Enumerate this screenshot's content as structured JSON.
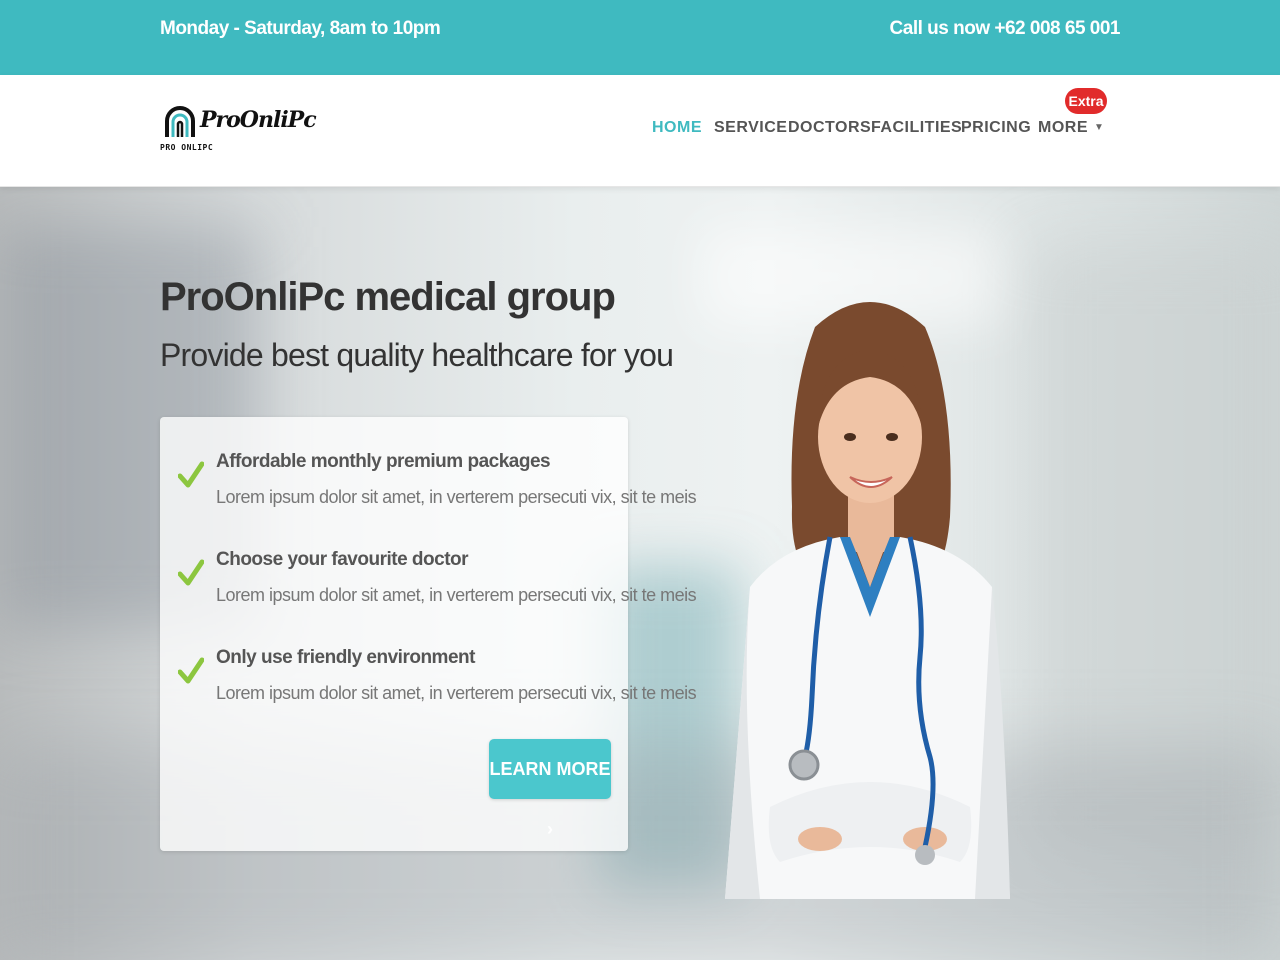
{
  "topbar": {
    "hours": "Monday - Saturday, 8am to 10pm",
    "phone": "Call us now +62 008 65 001"
  },
  "logo": {
    "word": "ProOnliPc",
    "sub": "PRO ONLIPC"
  },
  "nav": {
    "items": [
      {
        "label": "HOME",
        "active": true
      },
      {
        "label": "SERVICE"
      },
      {
        "label": "DOCTORS"
      },
      {
        "label": "FACILITIES"
      },
      {
        "label": "PRICING"
      },
      {
        "label": "MORE"
      }
    ],
    "more_badge": "Extra",
    "caret_icon": "caret-down-icon"
  },
  "hero": {
    "title": "ProOnliPc medical group",
    "subtitle": "Provide best quality healthcare for you",
    "features": [
      {
        "title": "Affordable monthly premium packages",
        "desc": "Lorem ipsum dolor sit amet, in verterem persecuti vix, sit te meis",
        "icon": "check-icon"
      },
      {
        "title": "Choose your favourite doctor",
        "desc": "Lorem ipsum dolor sit amet, in verterem persecuti vix, sit te meis",
        "icon": "check-icon"
      },
      {
        "title": "Only use friendly environment",
        "desc": "Lorem ipsum dolor sit amet, in verterem persecuti vix, sit te meis",
        "icon": "check-icon"
      }
    ],
    "cta": "LEARN MORE ›"
  },
  "colors": {
    "primary": "#3fbac0",
    "button": "#4bc7cd",
    "badge": "#e12b2b",
    "check": "#8cc63f"
  }
}
